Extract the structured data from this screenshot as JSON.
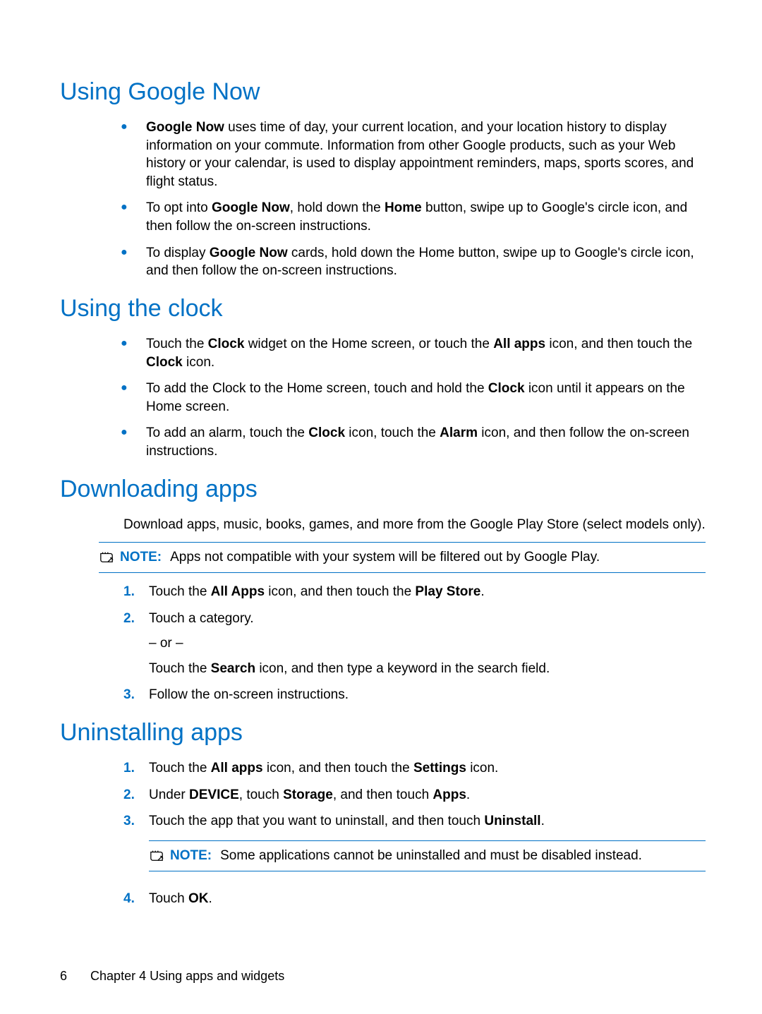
{
  "sections": {
    "google_now": {
      "heading": "Using Google Now",
      "bullets": [
        {
          "leading_bold": "Google Now",
          "text_after_lead": " uses time of day, your current location, and your location history to display information on your commute. Information from other Google products, such as your Web history or your calendar, is used to display appointment reminders, maps, sports scores, and flight status."
        },
        {
          "pre1": "To opt into ",
          "b1": "Google Now",
          "mid1": ", hold down the ",
          "b2": "Home",
          "post1": " button, swipe up to Google's circle icon, and then follow the on-screen instructions."
        },
        {
          "pre1": "To display ",
          "b1": "Google Now",
          "post1": " cards, hold down the Home button, swipe up to Google's circle icon, and then follow the on-screen instructions."
        }
      ]
    },
    "clock": {
      "heading": "Using the clock",
      "bullets": [
        {
          "pre1": "Touch the ",
          "b1": "Clock",
          "mid1": " widget on the Home screen, or touch the ",
          "b2": "All apps",
          "mid2": " icon, and then touch the ",
          "b3": "Clock",
          "post1": " icon."
        },
        {
          "pre1": "To add the Clock to the Home screen, touch and hold the ",
          "b1": "Clock",
          "post1": " icon until it appears on the Home screen."
        },
        {
          "pre1": "To add an alarm, touch the ",
          "b1": "Clock",
          "mid1": " icon, touch the ",
          "b2": "Alarm",
          "post1": " icon, and then follow the on-screen instructions."
        }
      ]
    },
    "downloading": {
      "heading": "Downloading apps",
      "intro": "Download apps, music, books, games, and more from the Google Play Store (select models only).",
      "note_label": "NOTE:",
      "note_text": "Apps not compatible with your system will be filtered out by Google Play.",
      "steps": [
        {
          "num": "1.",
          "pre1": "Touch the ",
          "b1": "All Apps",
          "mid1": " icon, and then touch the ",
          "b2": "Play Store",
          "post1": "."
        },
        {
          "num": "2.",
          "text": "Touch a category.",
          "or": "– or –",
          "sub_pre1": "Touch the ",
          "sub_b1": "Search",
          "sub_post1": " icon, and then type a keyword in the search field."
        },
        {
          "num": "3.",
          "text": "Follow the on-screen instructions."
        }
      ]
    },
    "uninstalling": {
      "heading": "Uninstalling apps",
      "steps": [
        {
          "num": "1.",
          "pre1": "Touch the ",
          "b1": "All apps",
          "mid1": " icon, and then touch the ",
          "b2": "Settings",
          "post1": " icon."
        },
        {
          "num": "2.",
          "pre1": "Under ",
          "b1": "DEVICE",
          "mid1": ", touch ",
          "b2": "Storage",
          "mid2": ", and then touch ",
          "b3": "Apps",
          "post1": "."
        },
        {
          "num": "3.",
          "pre1": "Touch the app that you want to uninstall, and then touch ",
          "b1": "Uninstall",
          "post1": ".",
          "note_label": "NOTE:",
          "note_text": "Some applications cannot be uninstalled and must be disabled instead."
        },
        {
          "num": "4.",
          "pre1": "Touch ",
          "b1": "OK",
          "post1": "."
        }
      ]
    }
  },
  "footer": {
    "page_number": "6",
    "chapter": "Chapter 4   Using apps and widgets"
  }
}
